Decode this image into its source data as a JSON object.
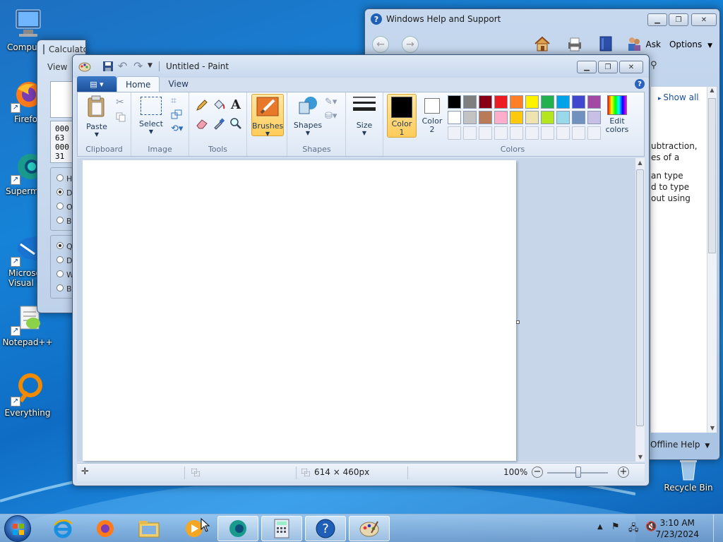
{
  "desktop": {
    "icons": [
      {
        "label": "Compu",
        "icon": "computer-icon"
      },
      {
        "label": "Firefo",
        "icon": "firefox-icon"
      },
      {
        "label": "Supermu",
        "icon": "supermium-icon"
      },
      {
        "label": "Microso\nVisual St",
        "icon": "visual-studio-icon"
      },
      {
        "label": "Notepad++",
        "icon": "notepadpp-icon"
      },
      {
        "label": "Everything",
        "icon": "everything-icon"
      },
      {
        "label": "Recycle Bin",
        "icon": "recycle-bin-icon"
      }
    ]
  },
  "calculator": {
    "title": "Calculator",
    "menu_view": "View",
    "lines": [
      "000",
      "63",
      "000",
      "31"
    ],
    "radio1": [
      "H",
      "D",
      "O",
      "Bi"
    ],
    "radio2": [
      "Q",
      "D",
      "W",
      "By"
    ]
  },
  "help": {
    "title": "Windows Help and Support",
    "ask": "Ask",
    "options": "Options",
    "show_all": "Show all",
    "text": [
      "ubtraction,",
      "es of a",
      "",
      "an type",
      "d to type",
      "out using"
    ],
    "offline": "Offline Help"
  },
  "paint": {
    "title": "Untitled - Paint",
    "tabs": [
      "Home",
      "View"
    ],
    "groups": {
      "clipboard": "Clipboard",
      "image": "Image",
      "tools": "Tools",
      "shapes": "Shapes",
      "colors": "Colors"
    },
    "buttons": {
      "paste": "Paste",
      "select": "Select",
      "brushes": "Brushes",
      "shapes": "Shapes",
      "size": "Size",
      "color1": "Color\n1",
      "color2": "Color\n2",
      "edit_colors": "Edit\ncolors"
    },
    "palette_row1": [
      "#000000",
      "#7f7f7f",
      "#880015",
      "#ed1c24",
      "#ff7f27",
      "#fff200",
      "#22b14c",
      "#00a2e8",
      "#3f48cc",
      "#a349a4"
    ],
    "palette_row2": [
      "#ffffff",
      "#c3c3c3",
      "#b97a57",
      "#ffaec9",
      "#ffc90e",
      "#efe4b0",
      "#b5e61d",
      "#99d9ea",
      "#7092be",
      "#c8bfe7"
    ],
    "color1": "#000000",
    "color2": "#ffffff",
    "status": {
      "size": "614 × 460px",
      "zoom": "100%"
    }
  },
  "taskbar": {
    "time": "3:10 AM",
    "date": "7/23/2024"
  }
}
